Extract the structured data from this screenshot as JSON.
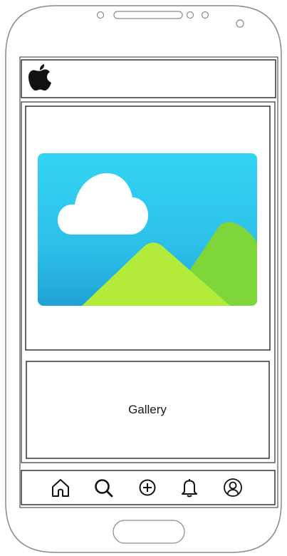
{
  "header": {
    "logo_icon": "apple-logo-icon"
  },
  "hero": {
    "image_icon": "landscape-image-icon",
    "colors": {
      "sky_top": "#33d4f2",
      "sky_bottom": "#1fa2d6",
      "cloud": "#ffffff",
      "mountain_front": "#b3eb3b",
      "mountain_back": "#7fd63a"
    }
  },
  "gallery": {
    "label": "Gallery"
  },
  "bottom_nav": {
    "items": [
      {
        "icon": "home-icon"
      },
      {
        "icon": "search-icon"
      },
      {
        "icon": "add-circle-icon"
      },
      {
        "icon": "bell-icon"
      },
      {
        "icon": "profile-icon"
      }
    ]
  }
}
